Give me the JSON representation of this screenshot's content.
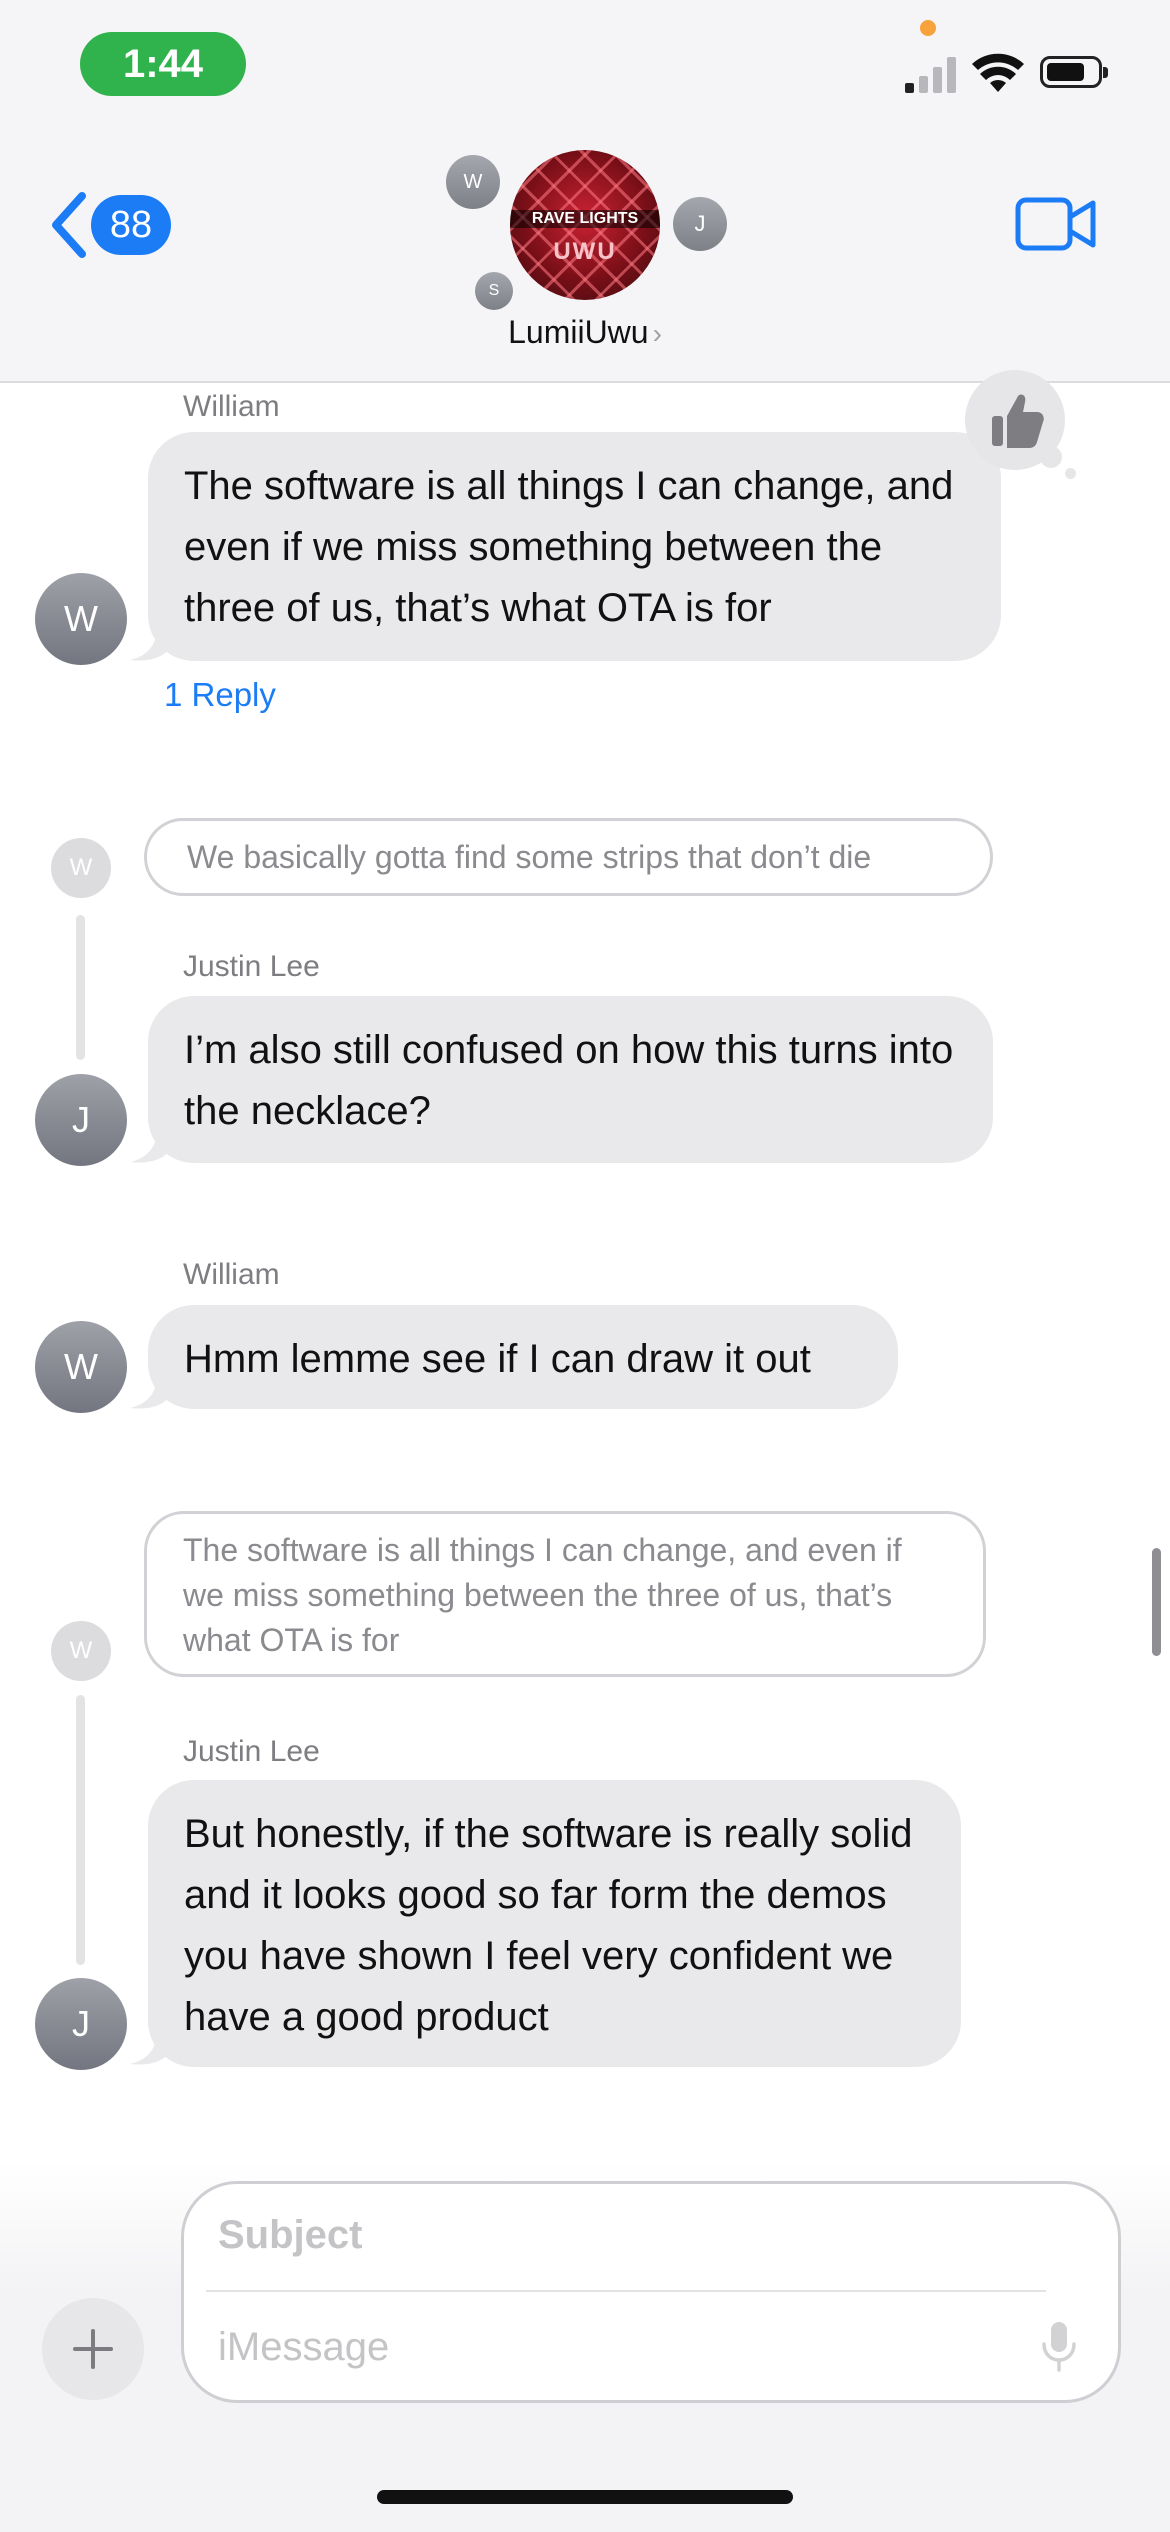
{
  "status_bar": {
    "time": "1:44"
  },
  "header": {
    "back_badge": "88",
    "group_name": "LumiiUwu",
    "group_avatar_line1": "RAVE LIGHTS",
    "group_avatar_line2": "UWU",
    "participants": [
      "W",
      "J",
      "S"
    ]
  },
  "messages": [
    {
      "sender": "William",
      "avatar": "W",
      "text": "The software is all things I can change, and even if we miss something between the three of us, that’s what OTA is for",
      "reply_link": "1 Reply",
      "tapback": "thumbs-up"
    },
    {
      "quoted": "We basically gotta find some strips that don’t die",
      "quoted_avatar": "W",
      "sender": "Justin Lee",
      "avatar": "J",
      "text": "I’m also still confused on how this turns into the necklace?"
    },
    {
      "sender": "William",
      "avatar": "W",
      "text": "Hmm lemme see if I can draw it out"
    },
    {
      "quoted": "The software is all things I can change, and even if we miss something between the three of us, that’s what OTA is for",
      "quoted_avatar": "W",
      "sender": "Justin Lee",
      "avatar": "J",
      "text": "But honestly, if the software is really solid and it looks good so far form the demos you have shown I feel very confident we have a good product"
    }
  ],
  "compose": {
    "subject_placeholder": "Subject",
    "message_placeholder": "iMessage"
  },
  "colors": {
    "accent": "#1b7cf5",
    "bubble_gray": "#e9e9eb",
    "time_pill": "#30b34d"
  }
}
